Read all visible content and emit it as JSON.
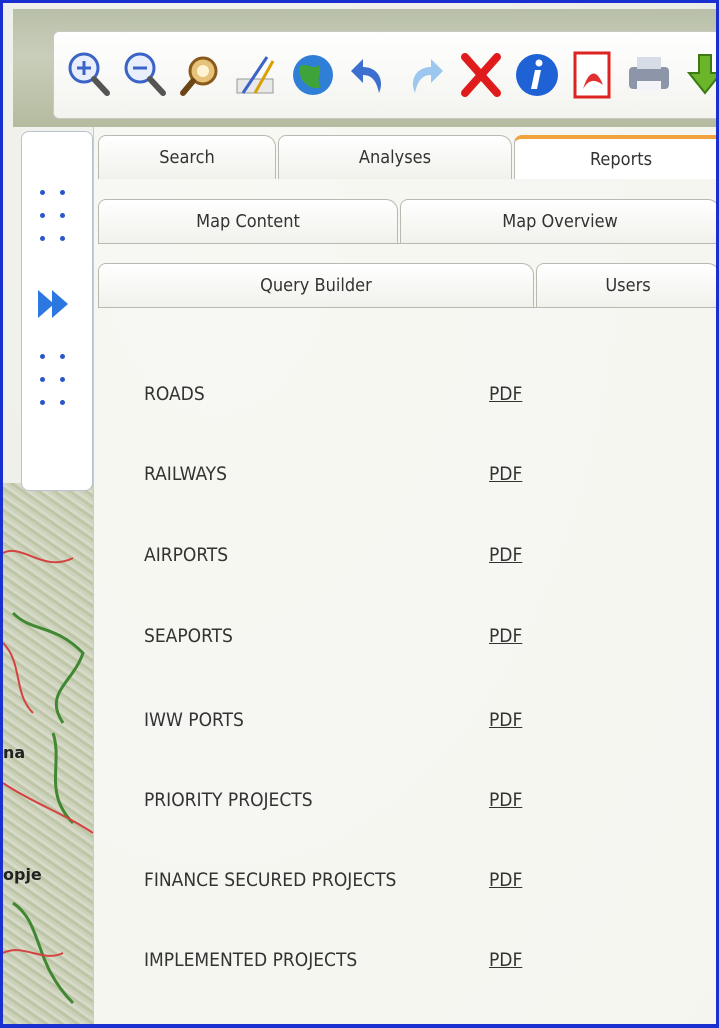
{
  "toolbar": {
    "icons": [
      "zoom-in-icon",
      "zoom-out-icon",
      "identify-icon",
      "measure-icon",
      "globe-icon",
      "undo-icon",
      "redo-icon",
      "clear-icon",
      "info-icon",
      "pdf-export-icon",
      "print-icon",
      "download-icon"
    ]
  },
  "map": {
    "labels": [
      "na",
      "opje"
    ]
  },
  "tabs": {
    "row1": [
      "Search",
      "Analyses",
      "Reports"
    ],
    "row2": [
      "Map Content",
      "Map Overview"
    ],
    "row3": [
      "Query Builder",
      "Users"
    ],
    "active": "Reports"
  },
  "reports": [
    {
      "name": "ROADS",
      "link": "PDF"
    },
    {
      "name": "RAILWAYS",
      "link": "PDF"
    },
    {
      "name": "AIRPORTS",
      "link": "PDF"
    },
    {
      "name": "SEAPORTS",
      "link": "PDF"
    },
    {
      "name": "IWW PORTS",
      "link": "PDF"
    },
    {
      "name": "PRIORITY PROJECTS",
      "link": "PDF"
    },
    {
      "name": "FINANCE SECURED PROJECTS",
      "link": "PDF"
    },
    {
      "name": "IMPLEMENTED PROJECTS",
      "link": "PDF"
    }
  ],
  "colors": {
    "frame": "#1a2fd0",
    "active_tab_accent": "#f2a23c",
    "dots": "#2a56c8"
  }
}
